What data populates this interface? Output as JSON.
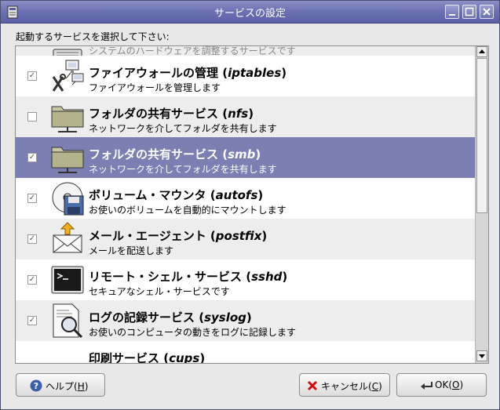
{
  "window": {
    "title": "サービスの設定",
    "icon": "app-icon",
    "controls": [
      "minimize-icon",
      "maximize-icon",
      "close-icon"
    ]
  },
  "instruction": "起動するサービスを選択して下さい:",
  "services": [
    {
      "name": "ファイアウォールの管理 (",
      "id": "iptables",
      "close": ")",
      "desc": "ファイアウォールを管理します",
      "checked": true,
      "icon": "network-computers-icon"
    },
    {
      "name": "フォルダの共有サービス (",
      "id": "nfs",
      "close": ")",
      "desc": "ネットワークを介してフォルダを共有します",
      "checked": false,
      "icon": "network-folder-icon"
    },
    {
      "name": "フォルダの共有サービス (",
      "id": "smb",
      "close": ")",
      "desc": "ネットワークを介してフォルダを共有します",
      "checked": true,
      "icon": "network-folder-icon",
      "selected": true
    },
    {
      "name": "ボリューム・マウンタ (",
      "id": "autofs",
      "close": ")",
      "desc": "お使いのボリュームを自動的にマウントします",
      "checked": true,
      "icon": "disk-volume-icon"
    },
    {
      "name": "メール・エージェント (",
      "id": "postfix",
      "close": ")",
      "desc": "メールを配送します",
      "checked": true,
      "icon": "mail-icon"
    },
    {
      "name": "リモート・シェル・サービス (",
      "id": "sshd",
      "close": ")",
      "desc": "セキュアなシェル・サービスです",
      "checked": true,
      "icon": "terminal-icon"
    },
    {
      "name": "ログの記録サービス (",
      "id": "syslog",
      "close": ")",
      "desc": "お使いのコンピュータの動きをログに記録します",
      "checked": true,
      "icon": "log-document-icon"
    }
  ],
  "partial_top_desc": "システムのハードウェアを調整するサービスです",
  "partial_bottom": {
    "name": "印刷サービス (",
    "id": "cups",
    "close": ")"
  },
  "buttons": {
    "help": {
      "label": "ヘルプ(",
      "mnemonic": "H",
      "close": ")",
      "icon": "help-icon"
    },
    "cancel": {
      "label": "キャンセル(",
      "mnemonic": "C",
      "close": ")",
      "icon": "cancel-x-icon"
    },
    "ok": {
      "label": "OK(",
      "mnemonic": "O",
      "close": ")",
      "icon": "ok-icon"
    }
  },
  "colors": {
    "selection": "#7b7fb2",
    "titlebar": "#6d72b3"
  }
}
